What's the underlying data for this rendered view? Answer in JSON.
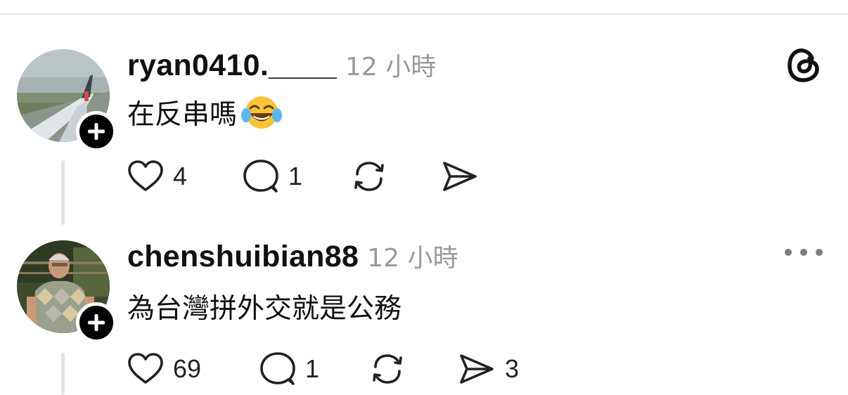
{
  "posts": [
    {
      "username": "ryan0410.____",
      "timestamp": "12 小時",
      "text": "在反串嗎",
      "emoji_icon": "face-with-tears-of-joy-icon",
      "likes": "4",
      "replies": "1",
      "reposts": "",
      "shares": "",
      "header_icon": "threads-logo-icon"
    },
    {
      "username": "chenshuibian88",
      "timestamp": "12 小時",
      "text": "為台灣拼外交就是公務",
      "likes": "69",
      "replies": "1",
      "reposts": "",
      "shares": "3",
      "header_icon": "more-options-icon"
    }
  ],
  "colors": {
    "text": "#101010",
    "muted": "#9a9a9a",
    "divider": "#e6e6e6",
    "badge": "#000000"
  }
}
